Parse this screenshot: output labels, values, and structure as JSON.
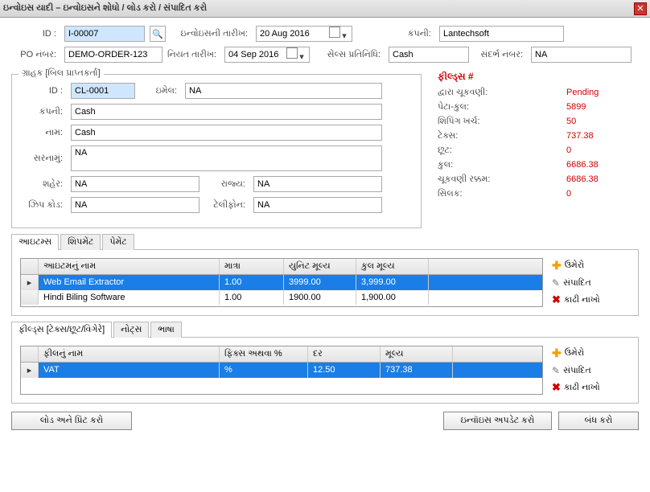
{
  "window": {
    "title": "ઇન્વોઇસ યાદી – ઇન્વોઇસને શોધો / લોડ કરો / સંપાદિત કરો"
  },
  "header": {
    "id_label": "ID :",
    "id_value": "I-00007",
    "date_label": "ઇન્વોઇસની તારીખ:",
    "date_value": "20 Aug 2016",
    "company_label": "કંપની:",
    "company_value": "Lantechsoft",
    "po_label": "PO નંબર:",
    "po_value": "DEMO-ORDER-123",
    "due_label": "નિયત તારીખ:",
    "due_value": "04 Sep 2016",
    "salesrep_label": "સેલ્સ પ્રતિનિધિ:",
    "salesrep_value": "Cash",
    "ref_label": "સંદર્ભ નંબર:",
    "ref_value": "NA"
  },
  "customer": {
    "legend": "ગ્રાહક [બિલ પ્રાપ્તકર્તા]",
    "id_label": "ID :",
    "id_value": "CL-0001",
    "email_label": "ઇમેલ:",
    "email_value": "NA",
    "company_label": "કંપની:",
    "company_value": "Cash",
    "name_label": "નામ:",
    "name_value": "Cash",
    "address_label": "સરનામું:",
    "address_value": "NA",
    "city_label": "શહેર:",
    "city_value": "NA",
    "state_label": "રાજ્ય:",
    "state_value": "NA",
    "zip_label": "ઝિપ કોડ:",
    "zip_value": "NA",
    "phone_label": "ટેલીફોન:",
    "phone_value": "NA"
  },
  "totals": {
    "heading": "ફીલ્ડ્સ #",
    "rows": [
      {
        "label": "દ્વારા ચૂકવણી:",
        "value": "Pending"
      },
      {
        "label": "પેટા-કુલ:",
        "value": "5899"
      },
      {
        "label": "શિપિંગ ખર્ચ:",
        "value": "50"
      },
      {
        "label": "ટેક્સ:",
        "value": "737.38"
      },
      {
        "label": "છૂટ:",
        "value": "0"
      },
      {
        "label": "કુલ:",
        "value": "6686.38"
      },
      {
        "label": "ચૂકવણી રક્કમ:",
        "value": "6686.38"
      },
      {
        "label": "સિલક:",
        "value": "0"
      }
    ]
  },
  "tabs_top": {
    "items": "આઇટમ્સ",
    "shipment": "શિપમેંટ",
    "payment": "પેમેંટ"
  },
  "items_grid": {
    "headers": {
      "name": "આઇટમનું નામ",
      "qty": "માત્રા",
      "unit": "યુનિટ મૂલ્ય",
      "total": "કુલ મૂલ્ય"
    },
    "widths": {
      "name": 225,
      "qty": 80,
      "unit": 90,
      "total": 90
    },
    "rows": [
      {
        "name": "Web Email Extractor",
        "qty": "1.00",
        "unit": "3999.00",
        "total": "3,999.00",
        "selected": true
      },
      {
        "name": "Hindi Biling Software",
        "qty": "1.00",
        "unit": "1900.00",
        "total": "1,900.00",
        "selected": false
      }
    ]
  },
  "tabs_bottom": {
    "fees": "ફીલ્ડ્સ [ટેક્સ/છૂટ/વિગેરે]",
    "notes": "નોટ્સ",
    "lang": "ભાષા"
  },
  "fees_grid": {
    "headers": {
      "name": "ફીલનું નામ",
      "fixpct": "ફિક્સ અથવા %",
      "rate": "દર",
      "value": "મૂલ્ય"
    },
    "widths": {
      "name": 225,
      "fixpct": 110,
      "rate": 90,
      "value": 90
    },
    "rows": [
      {
        "name": "VAT",
        "fixpct": "%",
        "rate": "12.50",
        "value": "737.38",
        "selected": true
      }
    ]
  },
  "actions": {
    "add": "ઉમેરો",
    "edit": "સંપાદિત",
    "delete": "કાઢી નાખો"
  },
  "footer": {
    "load": "લોડ અને પ્રિંટ કરો",
    "update": "ઇન્વૉઇસ અપડેટ કરો",
    "close": "બંધ કરો"
  }
}
